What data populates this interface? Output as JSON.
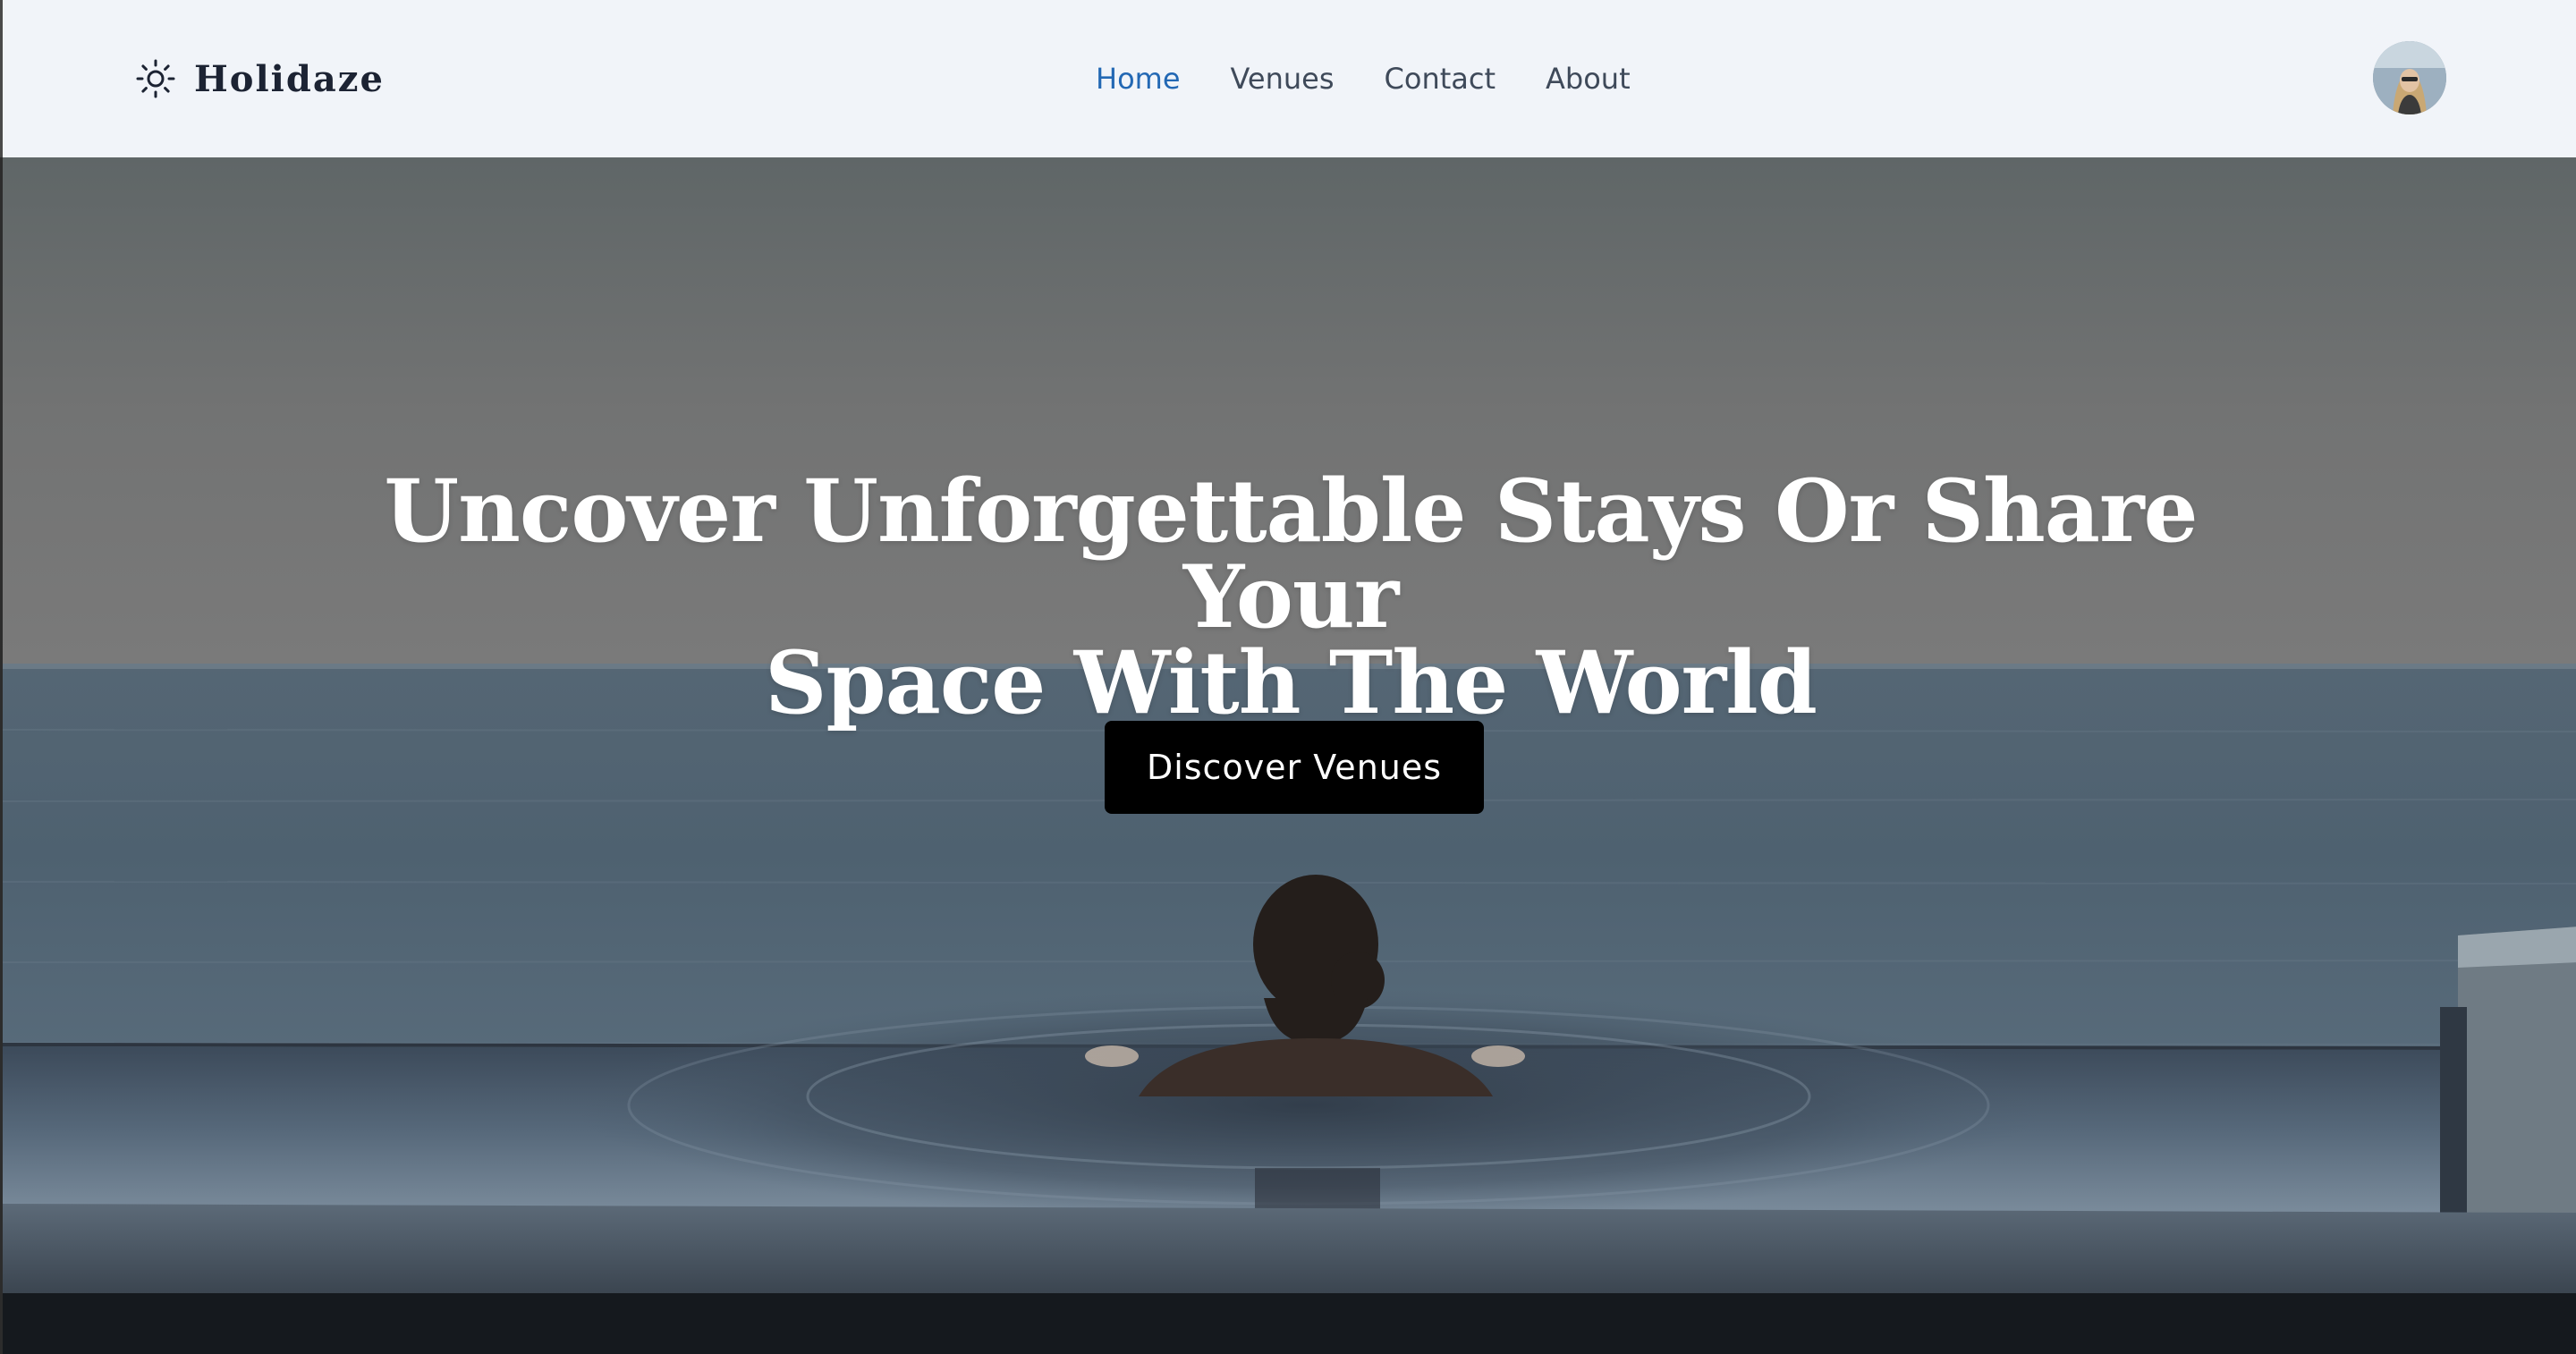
{
  "brand": {
    "name": "Holidaze",
    "icon": "sun-icon"
  },
  "nav": {
    "links": [
      {
        "label": "Home",
        "active": true
      },
      {
        "label": "Venues",
        "active": false
      },
      {
        "label": "Contact",
        "active": false
      },
      {
        "label": "About",
        "active": false
      }
    ],
    "active_color": "#2368b4",
    "text_color": "#3f4a5a"
  },
  "user": {
    "avatar_icon": "user-avatar"
  },
  "hero": {
    "title_line1": "Uncover Unforgettable Stays Or Share Your",
    "title_line2": "Space With The World",
    "cta_label": "Discover Venues",
    "background_image": "woman-in-infinity-pool-overlooking-sea"
  },
  "colors": {
    "navbar_bg": "#f1f4f9",
    "brand_text": "#1c2333",
    "cta_bg": "#000000",
    "cta_text": "#ffffff"
  }
}
